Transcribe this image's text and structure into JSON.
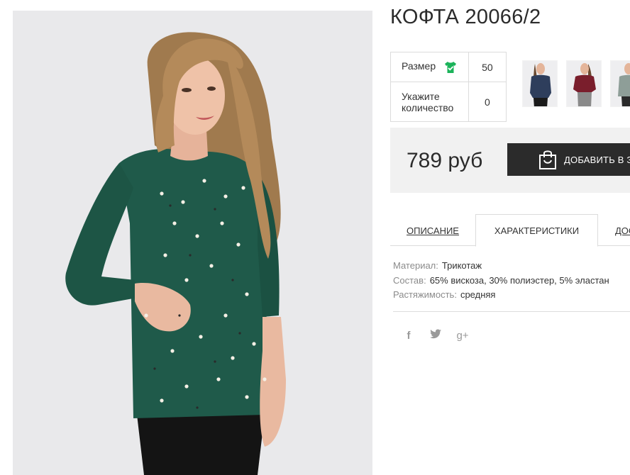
{
  "product": {
    "title": "КОФТА 20066/2",
    "price": "789 руб",
    "buy_label": "ДОБАВИТЬ В ЗА",
    "options": [
      {
        "label": "Размер",
        "value": "50",
        "icon": "tshirt-check-icon"
      },
      {
        "label": "Укажите количество",
        "value": "0"
      }
    ]
  },
  "thumbnails": [
    {
      "name": "navy-sweater-thumbnail",
      "color": "#2e3e5c"
    },
    {
      "name": "burgundy-sweater-thumbnail",
      "color": "#7a1e2c"
    },
    {
      "name": "gray-green-sweater-thumbnail",
      "color": "#8e9e98"
    }
  ],
  "tabs": [
    {
      "label": "ОПИСАНИЕ",
      "active": false
    },
    {
      "label": "ХАРАКТЕРИСТИКИ",
      "active": true
    },
    {
      "label": "ДОС",
      "active": false
    }
  ],
  "characteristics": [
    {
      "key": "Материал:",
      "value": "Трикотаж"
    },
    {
      "key": "Состав:",
      "value": "65% вискоза, 30% полиэстер, 5% эластан"
    },
    {
      "key": "Растяжимость:",
      "value": "средняя"
    }
  ],
  "social": [
    {
      "icon": "facebook-icon",
      "glyph": "f"
    },
    {
      "icon": "twitter-icon",
      "glyph": "🐦"
    },
    {
      "icon": "google-plus-icon",
      "glyph": "g+"
    }
  ],
  "colors": {
    "sweater": "#1f5a4a",
    "accent_green": "#1bb35a",
    "button_dark": "#2b2b2b",
    "panel_bg": "#f1f1f1"
  }
}
